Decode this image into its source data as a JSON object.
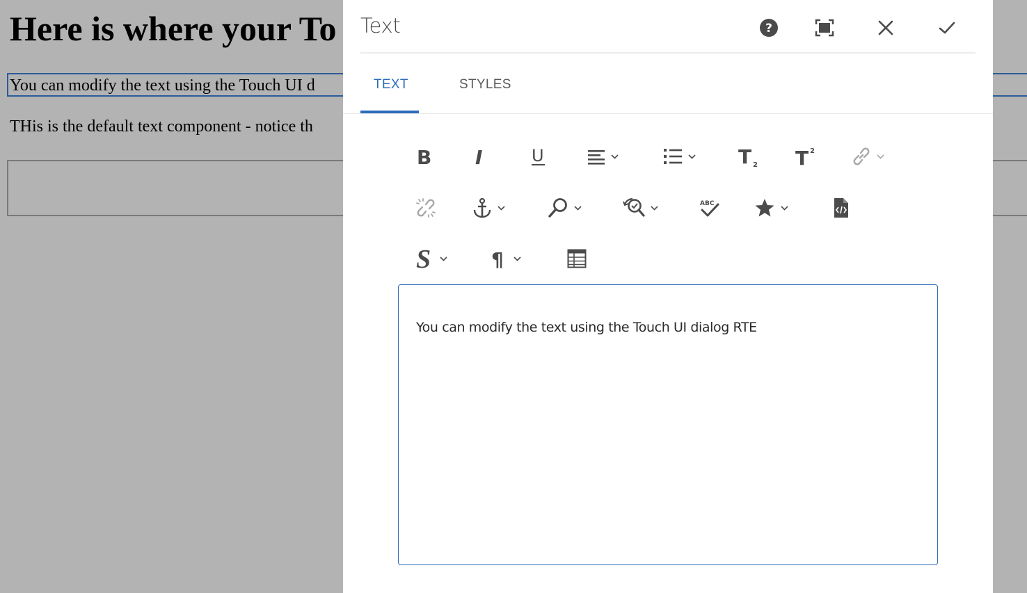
{
  "background_page": {
    "heading": "Here is where your To",
    "selected_text": "You can modify the text using the Touch UI d",
    "default_text": "THis is the default text component - notice th"
  },
  "dialog": {
    "title": "Text",
    "header_buttons": {
      "help": "help-icon",
      "fullscreen": "fullscreen-icon",
      "close": "close-icon",
      "done": "checkmark-icon"
    },
    "tabs": [
      {
        "label": "TEXT",
        "active": true
      },
      {
        "label": "STYLES",
        "active": false
      }
    ],
    "toolbar": {
      "rows": [
        [
          "bold",
          "italic",
          "underline",
          "justify",
          "lists",
          "subscript",
          "superscript",
          "link"
        ],
        [
          "unlink",
          "anchor",
          "find",
          "replace",
          "spellcheck",
          "special-characters",
          "source-edit"
        ],
        [
          "styles",
          "paragraph-format",
          "table"
        ]
      ]
    },
    "editor": {
      "content": "You can modify the text using the Touch UI dialog RTE"
    }
  },
  "colors": {
    "accent": "#2b6cbb",
    "overlay": "#b3b3b3",
    "icon": "#4b4b4b",
    "icon_disabled": "#a8a8a8"
  }
}
